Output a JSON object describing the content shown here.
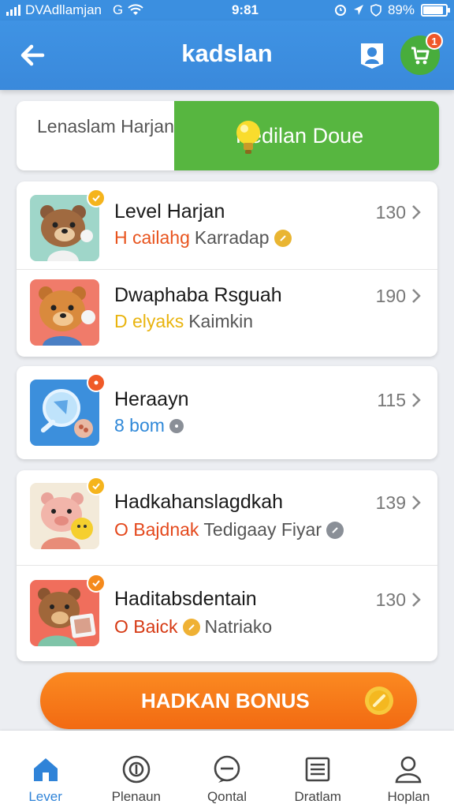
{
  "status_bar": {
    "carrier": "DVAdllamjan",
    "network": "G",
    "time": "9:81",
    "battery": "89%",
    "battery_level": 0.89
  },
  "header": {
    "title": "kadslan",
    "back_icon": "arrow-left-icon",
    "profile_icon": "person-icon",
    "cart_icon": "cart-icon",
    "cart_badge": "1"
  },
  "banner": {
    "left_text": "Lenaslam Harjan",
    "right_text": "Kedilan Doue",
    "right_icon": "lightbulb-icon"
  },
  "lists": [
    {
      "items": [
        {
          "title": "Level Harjan",
          "tag": "H cailahg",
          "tag_color": "#e8541e",
          "rest": "Karradap",
          "count": "130"
        },
        {
          "title": "Dwaphaba Rsguah",
          "tag": "D elyaks",
          "tag_color": "#e9b40f",
          "rest": "Kaimkin",
          "count": "190"
        }
      ]
    },
    {
      "items": [
        {
          "title": "Heraayn",
          "tag": "8 bom",
          "tag_color": "#2f88d8",
          "rest": "",
          "count": "115"
        }
      ]
    },
    {
      "items": [
        {
          "title": "Hadkahanslagdkah",
          "tag": "O Bajdnak",
          "tag_color": "#e4481c",
          "rest": "Tedigaay Fiyar",
          "count": "139"
        },
        {
          "title": "Haditabsdentain",
          "tag": "O Baick",
          "tag_color": "#d63a14",
          "rest": "Natriako",
          "count": "130"
        }
      ]
    }
  ],
  "bonus_button": {
    "label": "HADKAN BONUS"
  },
  "bottom_nav": [
    {
      "label": "Lever",
      "icon": "home-icon",
      "active": true
    },
    {
      "label": "Plenaun",
      "icon": "coin-icon",
      "active": false
    },
    {
      "label": "Qontal",
      "icon": "chat-icon",
      "active": false
    },
    {
      "label": "Dratlam",
      "icon": "list-icon",
      "active": false
    },
    {
      "label": "Hoplan",
      "icon": "user-icon",
      "active": false
    }
  ],
  "colors": {
    "primary": "#3b8fe0",
    "accent_green": "#57b640",
    "bonus_orange": "#f47a18"
  }
}
